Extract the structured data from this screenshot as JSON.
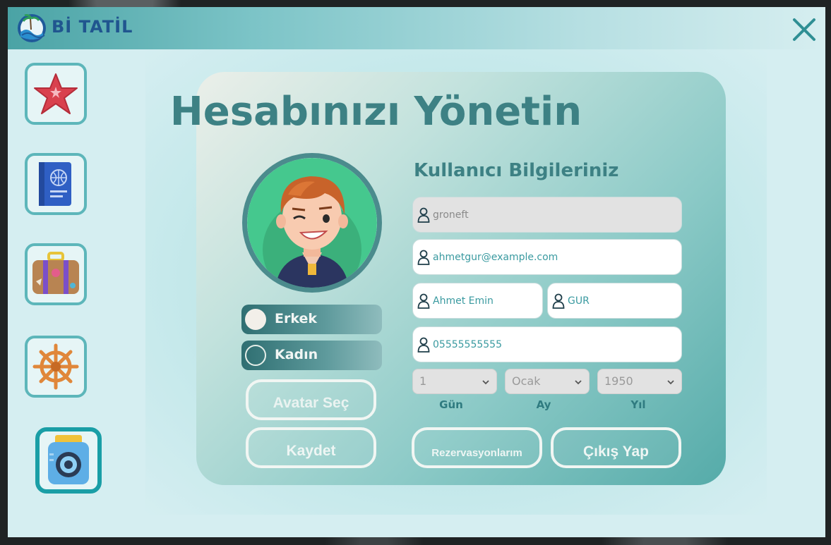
{
  "app": {
    "brand": "Bİ TATİL"
  },
  "sidebar": {
    "items": [
      {
        "name": "favorites",
        "icon": "starfish-icon"
      },
      {
        "name": "passport",
        "icon": "passport-icon"
      },
      {
        "name": "luggage",
        "icon": "suitcase-icon"
      },
      {
        "name": "cruise",
        "icon": "ship-wheel-icon"
      },
      {
        "name": "account",
        "icon": "camera-icon",
        "active": true
      }
    ]
  },
  "page": {
    "title": "Hesabınızı Yönetin"
  },
  "profile": {
    "gender_options": [
      {
        "label": "Erkek",
        "selected": true
      },
      {
        "label": "Kadın",
        "selected": false
      }
    ],
    "avatar_button": "Avatar Seç",
    "save_button": "Kaydet"
  },
  "user_info": {
    "title": "Kullanıcı Bilgileriniz",
    "username": "groneft",
    "email": "ahmetgur@example.com",
    "first_name": "Ahmet Emin",
    "last_name": "GÜR",
    "phone": "05555555555",
    "birth_day": "1",
    "birth_month": "Ocak",
    "birth_year": "1950",
    "day_label": "Gün",
    "month_label": "Ay",
    "year_label": "Yıl"
  },
  "actions": {
    "reservations": "Rezervasyonlarım",
    "logout": "Çıkış Yap"
  },
  "colors": {
    "accent": "#3d8184",
    "title_bar": "#4aa3a5",
    "brand_text": "#20558f"
  }
}
